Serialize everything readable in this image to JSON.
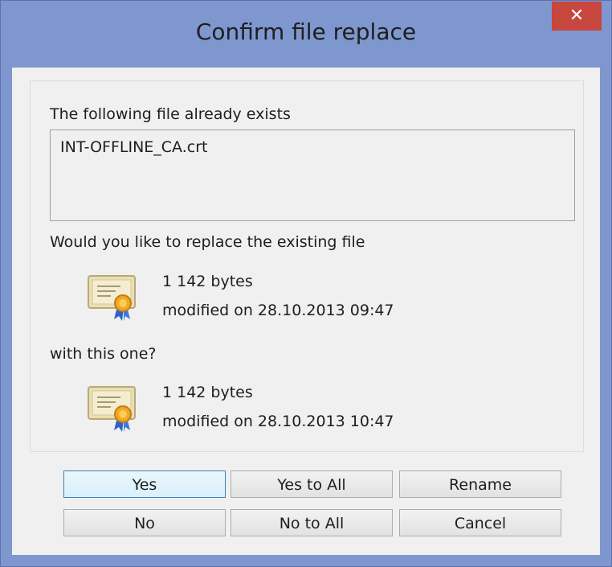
{
  "window": {
    "title": "Confirm file replace",
    "close_glyph": "✕"
  },
  "dialog": {
    "exists_label": "The following file already exists",
    "file_name": "INT-OFFLINE_CA.crt",
    "replace_question": "Would you like to replace the existing file",
    "existing": {
      "size": "1 142 bytes",
      "modified": "modified on 28.10.2013 09:47"
    },
    "with_label": "with this one?",
    "new": {
      "size": "1 142 bytes",
      "modified": "modified on 28.10.2013 10:47"
    }
  },
  "buttons": {
    "yes": "Yes",
    "yes_to_all": "Yes to All",
    "rename": "Rename",
    "no": "No",
    "no_to_all": "No to All",
    "cancel": "Cancel"
  },
  "icons": {
    "file": "certificate-icon",
    "close": "close-icon"
  },
  "colors": {
    "titlebar": "#7f97cf",
    "close_button": "#c7463e",
    "client": "#f0f0f0",
    "default_button_border": "#3c7fb1"
  }
}
